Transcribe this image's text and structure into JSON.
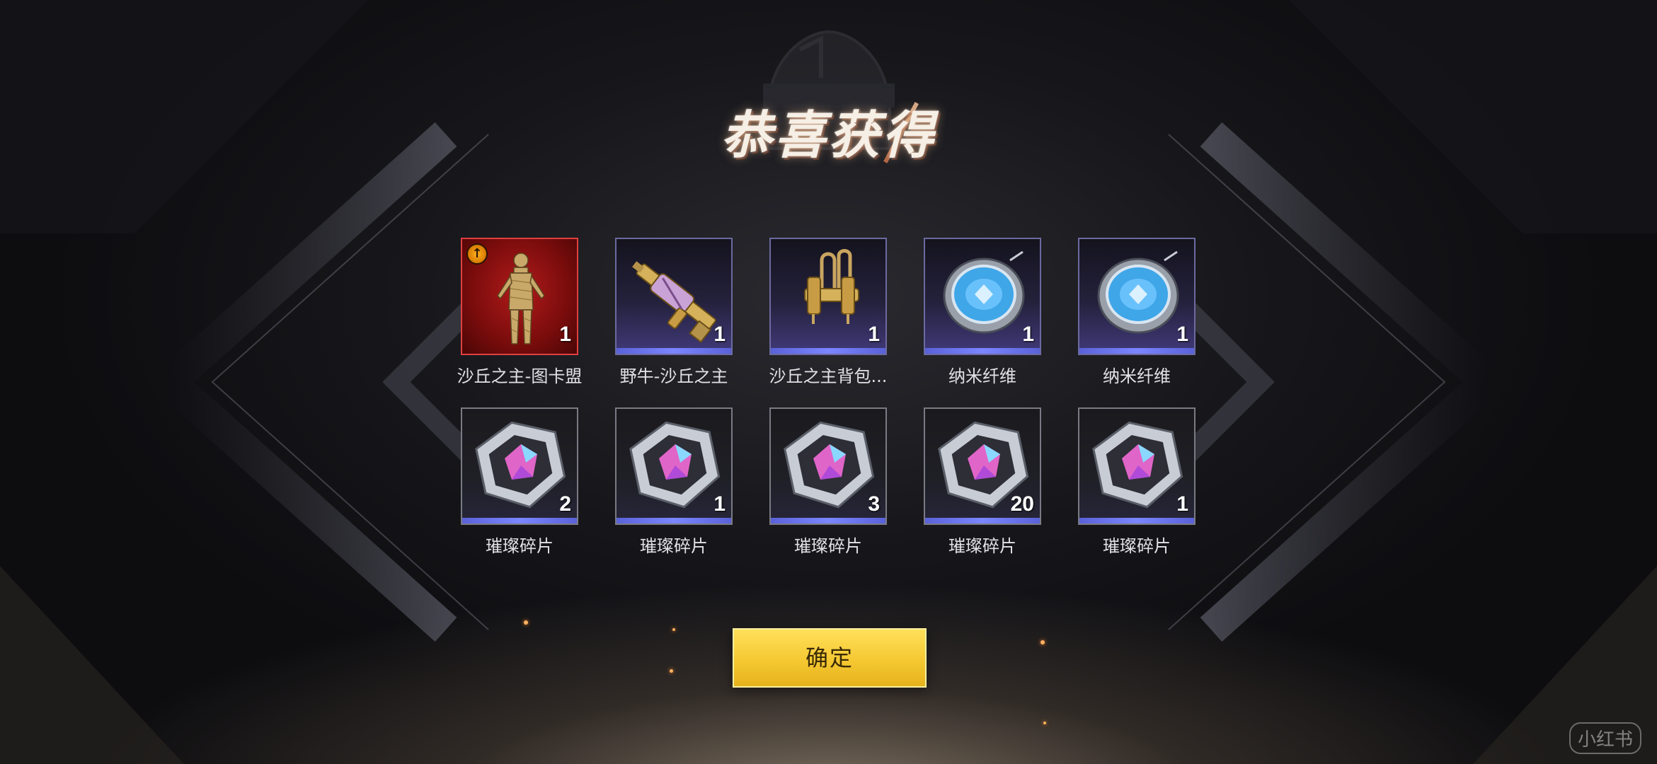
{
  "title": "恭喜获得",
  "rewards": [
    {
      "name": "沙丘之主-图卡盟",
      "count": "1",
      "icon": "golden-mummy-outfit-icon",
      "tier": "red",
      "upgradeable": true
    },
    {
      "name": "野牛-沙丘之主",
      "count": "1",
      "icon": "golden-bizon-smg-icon",
      "tier": "purple"
    },
    {
      "name": "沙丘之主背包...",
      "count": "1",
      "icon": "golden-backpack-straps-icon",
      "tier": "purple"
    },
    {
      "name": "纳米纤维",
      "count": "1",
      "icon": "nano-fiber-disc-icon",
      "tier": "purple"
    },
    {
      "name": "纳米纤维",
      "count": "1",
      "icon": "nano-fiber-disc-icon",
      "tier": "purple"
    },
    {
      "name": "璀璨碎片",
      "count": "2",
      "icon": "brilliant-shard-hexagon-icon",
      "tier": "dark"
    },
    {
      "name": "璀璨碎片",
      "count": "1",
      "icon": "brilliant-shard-hexagon-icon",
      "tier": "dark"
    },
    {
      "name": "璀璨碎片",
      "count": "3",
      "icon": "brilliant-shard-hexagon-icon",
      "tier": "dark"
    },
    {
      "name": "璀璨碎片",
      "count": "20",
      "icon": "brilliant-shard-hexagon-icon",
      "tier": "dark"
    },
    {
      "name": "璀璨碎片",
      "count": "1",
      "icon": "brilliant-shard-hexagon-icon",
      "tier": "dark"
    }
  ],
  "confirm_label": "确定",
  "watermark": "小红书",
  "colors": {
    "accent_gold": "#f5c832",
    "rarity_red": "#b11a1a",
    "rarity_purple": "#413a7a",
    "rarity_bar": "#6f79f5"
  }
}
